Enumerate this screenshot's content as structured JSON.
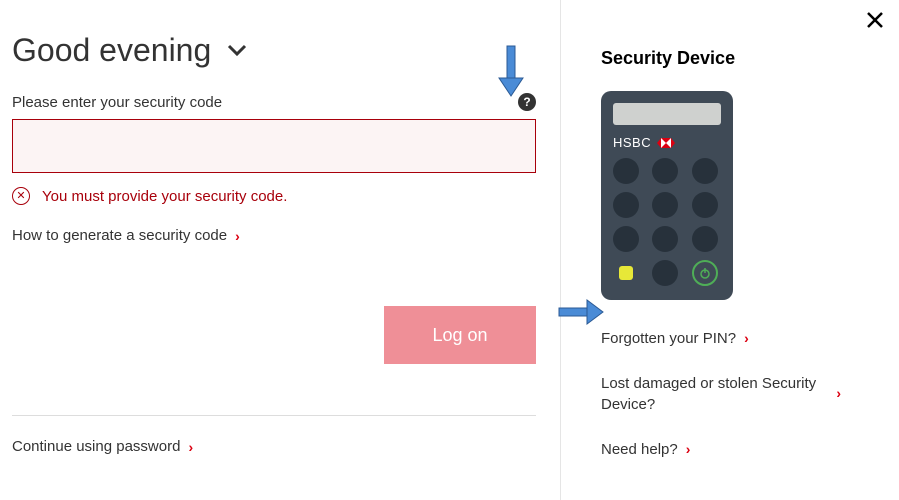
{
  "greeting": "Good evening",
  "form": {
    "label": "Please enter your security code",
    "help_char": "?",
    "input_value": "",
    "error_text": "You must provide your security code.",
    "generate_link": "How to generate a security code",
    "logon_label": "Log on",
    "continue_password": "Continue using password"
  },
  "sidebar": {
    "title": "Security Device",
    "brand": "HSBC",
    "links": {
      "forgot_pin": "Forgotten your PIN?",
      "lost_device": "Lost damaged or stolen Security Device?",
      "need_help": "Need help?"
    }
  }
}
